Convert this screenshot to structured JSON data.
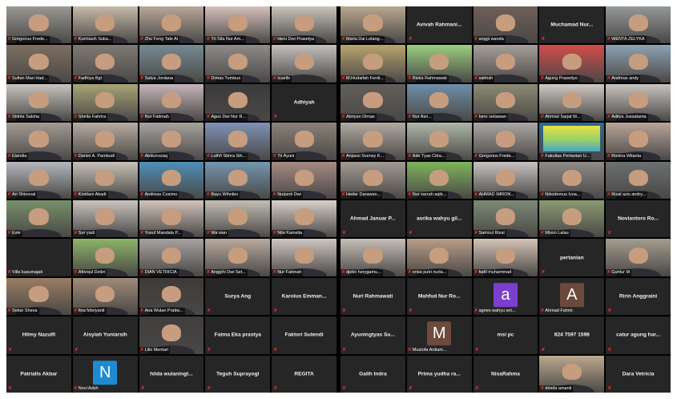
{
  "colors": {
    "background": "#000000",
    "tile": "#262626",
    "mic_muted": "#e0312e",
    "avatar_n": "#1f8ad2",
    "avatar_m": "#6d4a3c",
    "avatar_a_purple": "#7b3fd0",
    "avatar_a_brown": "#6b4a3c"
  },
  "icons": {
    "muted_mic": "muted-mic-icon"
  },
  "left_panel": [
    {
      "type": "video",
      "name": "Gregorius Frede...",
      "bg": "#9b9894"
    },
    {
      "type": "video",
      "name": "Kurniasih Suka...",
      "bg": "#c7b9a8"
    },
    {
      "type": "video",
      "name": "Zhu Feng Tate Al",
      "bg": "#b8a79a"
    },
    {
      "type": "video",
      "name": "Tri Sila Nur Am...",
      "bg": "#d6c0bb"
    },
    {
      "type": "video",
      "name": "Heru Dwi Prasetya",
      "bg": "#c9c3bb"
    },
    {
      "type": "video",
      "name": "Sultan Mari Had...",
      "bg": "#7d6f62"
    },
    {
      "type": "video",
      "name": "Fadhiya Bgt",
      "bg": "#807a75"
    },
    {
      "type": "video",
      "name": "Satya Jordana",
      "bg": "#768b93"
    },
    {
      "type": "video",
      "name": "Dimas Tumbus",
      "bg": "#8f8b8b"
    },
    {
      "type": "video",
      "name": "Icuelle",
      "bg": "#c4bfbd"
    },
    {
      "type": "video",
      "name": "Shinta Salsha",
      "bg": "#c7c3bf"
    },
    {
      "type": "video",
      "name": "Sheila Fahrira",
      "bg": "#a9a476"
    },
    {
      "type": "video",
      "name": "Nur Fatimah",
      "bg": "#c4b5b8"
    },
    {
      "type": "video",
      "name": "Agus Dwi Nur R...",
      "bg": "#3c3b3c"
    },
    {
      "type": "name",
      "name": "Adhiyah"
    },
    {
      "type": "video",
      "name": "Elandia",
      "bg": "#a39b94"
    },
    {
      "type": "video",
      "name": "Daniel A. Pambudi",
      "bg": "#b7aca2"
    },
    {
      "type": "video",
      "name": "Abdurrozaq",
      "bg": "#a6a29f"
    },
    {
      "type": "video",
      "name": "Luthfi Sbhra Sih...",
      "bg": "#7f92b7"
    },
    {
      "type": "video",
      "name": "Tri Ayuni",
      "bg": "#8c8179"
    },
    {
      "type": "video",
      "name": "Ari Shinoval",
      "bg": "#b4b7bd"
    },
    {
      "type": "video",
      "name": "Kristiani Abadi",
      "bg": "#c7c1b8"
    },
    {
      "type": "video",
      "name": "Andreas Cosimo",
      "bg": "#4e90b8"
    },
    {
      "type": "video",
      "name": "Bayu Wihniko",
      "bg": "#7298b0"
    },
    {
      "type": "video",
      "name": "Nurjanti Dwi",
      "bg": "#a78b84"
    },
    {
      "type": "video",
      "name": "Evie",
      "bg": "#77916a"
    },
    {
      "type": "video",
      "name": "Sur yadi",
      "bg": "#c9c4be"
    },
    {
      "type": "video",
      "name": "Yusuf Mandala P...",
      "bg": "#d1c3ba"
    },
    {
      "type": "video",
      "name": "Wa wan",
      "bg": "#c3beb4"
    },
    {
      "type": "video",
      "name": "Nila Kamelia",
      "bg": "#d8d0cb"
    },
    {
      "type": "name",
      "name": "Villa kusumajati",
      "corner": true
    },
    {
      "type": "video",
      "name": "Afrizqul Dzikri",
      "bg": "#8db468"
    },
    {
      "type": "video",
      "name": "DIAN VETRICIA",
      "bg": "#a6a2a0"
    },
    {
      "type": "video",
      "name": "Anggihi Dwi Set...",
      "bg": "#b8a99e"
    },
    {
      "type": "video",
      "name": "Nur Fatimah",
      "bg": "#cfc6c1"
    },
    {
      "type": "video",
      "name": "Sekar Sheva",
      "bg": "#9b7d62"
    },
    {
      "type": "video",
      "name": "fina febriyanti",
      "bg": "#a08b78"
    },
    {
      "type": "video",
      "name": "Ana Wulan Pratiw...",
      "bg": "#3d3a38"
    },
    {
      "type": "name",
      "name": "Surya Ang"
    },
    {
      "type": "name",
      "name": "Karolus Emman..."
    },
    {
      "type": "name",
      "name": "Hilmy Nazulfi"
    },
    {
      "type": "name",
      "name": "Aisyiah Yuniarsih"
    },
    {
      "type": "video",
      "name": "Lilis Mentari",
      "bg": "#403d3d"
    },
    {
      "type": "name",
      "name": "Fatma Eka prastya"
    },
    {
      "type": "name",
      "name": "Faktori Sutendi"
    },
    {
      "type": "name",
      "name": "Patrialis Akbar"
    },
    {
      "type": "avatar",
      "name": "Novi Adsh",
      "letter": "N",
      "color": "#1f8ad2"
    },
    {
      "type": "name",
      "name": "hilda  wulaningt..."
    },
    {
      "type": "name",
      "name": "Teguh Suprayogi"
    },
    {
      "type": "name",
      "name": "REGITA"
    }
  ],
  "right_panel": [
    {
      "type": "video",
      "name": "Maria Dai Lelang...",
      "bg": "#b9a78f"
    },
    {
      "type": "name",
      "name": "Avivah Rahmani..."
    },
    {
      "type": "video",
      "name": "anggi wanda",
      "bg": "#6f5f58"
    },
    {
      "type": "name",
      "name": "Muchamad Nur..."
    },
    {
      "type": "video",
      "name": "WENTA ZELYKA",
      "bg": "#939898"
    },
    {
      "type": "video",
      "name": "M.Hudaifah Ferdi...",
      "bg": "#b9a56d"
    },
    {
      "type": "video",
      "name": "Riska Rahmawati",
      "bg": "#9bcf7e"
    },
    {
      "type": "video",
      "name": "salmah",
      "bg": "#a7a09b"
    },
    {
      "type": "video",
      "name": "Agung Prasetiyo",
      "bg": "#d44d4b"
    },
    {
      "type": "video",
      "name": "Andreas andy",
      "bg": "#8da2b4"
    },
    {
      "type": "video",
      "name": "Abriyan Dimas",
      "bg": "#625f5b"
    },
    {
      "type": "video",
      "name": "Nur Asri...",
      "bg": "#6e8faa"
    },
    {
      "type": "video",
      "name": "heru setiawan",
      "bg": "#8d8a74"
    },
    {
      "type": "video",
      "name": "Ahmad Sarjat M...",
      "bg": "#cdc8c2"
    },
    {
      "type": "video",
      "name": "Aditya Jussatama",
      "bg": "#c9c3bf"
    },
    {
      "type": "video",
      "name": "Anjassi Svensy K...",
      "bg": "#b1a9a3"
    },
    {
      "type": "video",
      "name": "Ade Tyas Citra...",
      "bg": "#aeb7a9"
    },
    {
      "type": "video",
      "name": "Gregorius Frede...",
      "bg": "#a9a6a3"
    },
    {
      "type": "slide",
      "name": "Fakultas Pertanian U...",
      "bg": "#2b6b93"
    },
    {
      "type": "video",
      "name": "Rosina Wilanta",
      "bg": "#b9a49a"
    },
    {
      "type": "video",
      "name": "Hedar Darawan...",
      "bg": "#a39a92"
    },
    {
      "type": "video",
      "name": "Nur sarrah aqib...",
      "bg": "#7fb55b"
    },
    {
      "type": "video",
      "name": "AHMAD IMRON...",
      "bg": "#c7c2bf"
    },
    {
      "type": "video",
      "name": "Nikodemus Ivoa...",
      "bg": "#8e8b89"
    },
    {
      "type": "video",
      "name": "Rizal azis andry...",
      "bg": "#6a7170"
    },
    {
      "type": "name",
      "name": "Ahmad Januar P..."
    },
    {
      "type": "name",
      "name": "asrika wahyu gil..."
    },
    {
      "type": "video",
      "name": "Samsul Rizal",
      "bg": "#7c8a76"
    },
    {
      "type": "video",
      "name": "Misso Lalau",
      "bg": "#8a9a74"
    },
    {
      "type": "name",
      "name": "Noviantoro Ro..."
    },
    {
      "type": "video",
      "name": "djoko herygamu...",
      "bg": "#c6bfb8"
    },
    {
      "type": "video",
      "name": "erisa putri nurla...",
      "bg": "#b99d8a"
    },
    {
      "type": "video",
      "name": "fadil muhammad",
      "bg": "#d3c3b5"
    },
    {
      "type": "name",
      "name": "pertanian"
    },
    {
      "type": "video",
      "name": "Guntur M",
      "bg": "#a49c8e"
    },
    {
      "type": "name",
      "name": "Nuri Rahmawati"
    },
    {
      "type": "name",
      "name": "Mahfud Nur Ro..."
    },
    {
      "type": "avatar",
      "name": "agnes wahyu set...",
      "letter": "a",
      "color": "#7b3fd0"
    },
    {
      "type": "avatar",
      "name": "Ahmad Fahmi",
      "letter": "A",
      "color": "#6b4a3c"
    },
    {
      "type": "name",
      "name": "Ririn Anggraini"
    },
    {
      "type": "name",
      "name": "Ayuningtyas Su..."
    },
    {
      "type": "avatar",
      "name": "Mustofa Ardiam...",
      "letter": "M",
      "color": "#6d4a3c"
    },
    {
      "type": "name",
      "name": "msi pc"
    },
    {
      "type": "name",
      "name": "824 7597 1598"
    },
    {
      "type": "name",
      "name": "catur agung har..."
    },
    {
      "type": "name",
      "name": "Galih Indra"
    },
    {
      "type": "name",
      "name": "Prima yudha ra..."
    },
    {
      "type": "name",
      "name": "NisaRahma"
    },
    {
      "type": "video",
      "name": "drisda amanti",
      "bg": "#bba88e"
    },
    {
      "type": "name",
      "name": "Dara Vetricia"
    }
  ]
}
